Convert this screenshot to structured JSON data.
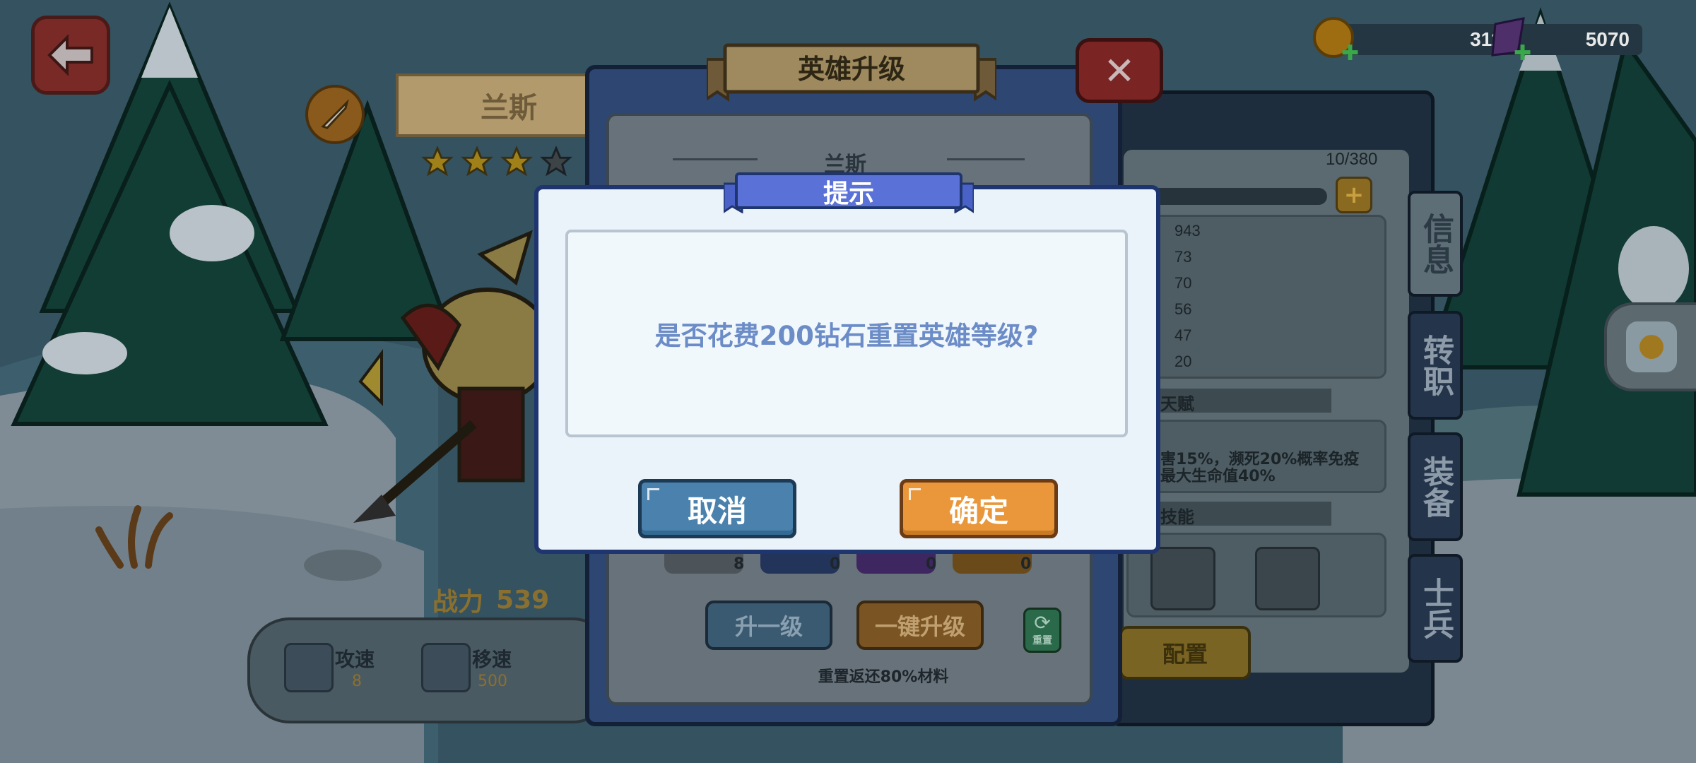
{
  "currency": {
    "gold": "311000",
    "gems": "5070"
  },
  "hero_panel": {
    "hero_name": "兰斯",
    "power_label": "战力",
    "power_value": "539",
    "stats": [
      {
        "label": "攻速",
        "value": "8"
      },
      {
        "label": "移速",
        "value": "500"
      }
    ],
    "stars_filled": 3,
    "stars_total": 4
  },
  "upgrade_panel": {
    "title": "英雄升级",
    "hero_name": "兰斯",
    "material_counts": [
      "8",
      "0",
      "0",
      "0"
    ],
    "level_up_label": "升一级",
    "one_click_label": "一键升级",
    "reset_label": "重置",
    "refund_note": "重置返还80%材料"
  },
  "info_panel": {
    "progress": "10/380",
    "stat_values": [
      "943",
      "73",
      "70",
      "56",
      "47",
      "20"
    ],
    "talent_header": "天赋",
    "talent_text_1": "害15%，濒死20%概率免疫",
    "talent_text_2": "最大生命值40%",
    "skills_header": "技能",
    "config_label": "配置",
    "tabs": [
      "信息",
      "转职",
      "装备",
      "士兵"
    ]
  },
  "dialog": {
    "title": "提示",
    "message": "是否花费200钻石重置英雄等级?",
    "cancel_label": "取消",
    "confirm_label": "确定"
  },
  "colors": {
    "dialog_border": "#1f3570",
    "message_text": "#6c8cc8",
    "cancel_button": "#4a82ad",
    "confirm_button": "#e9973a"
  }
}
